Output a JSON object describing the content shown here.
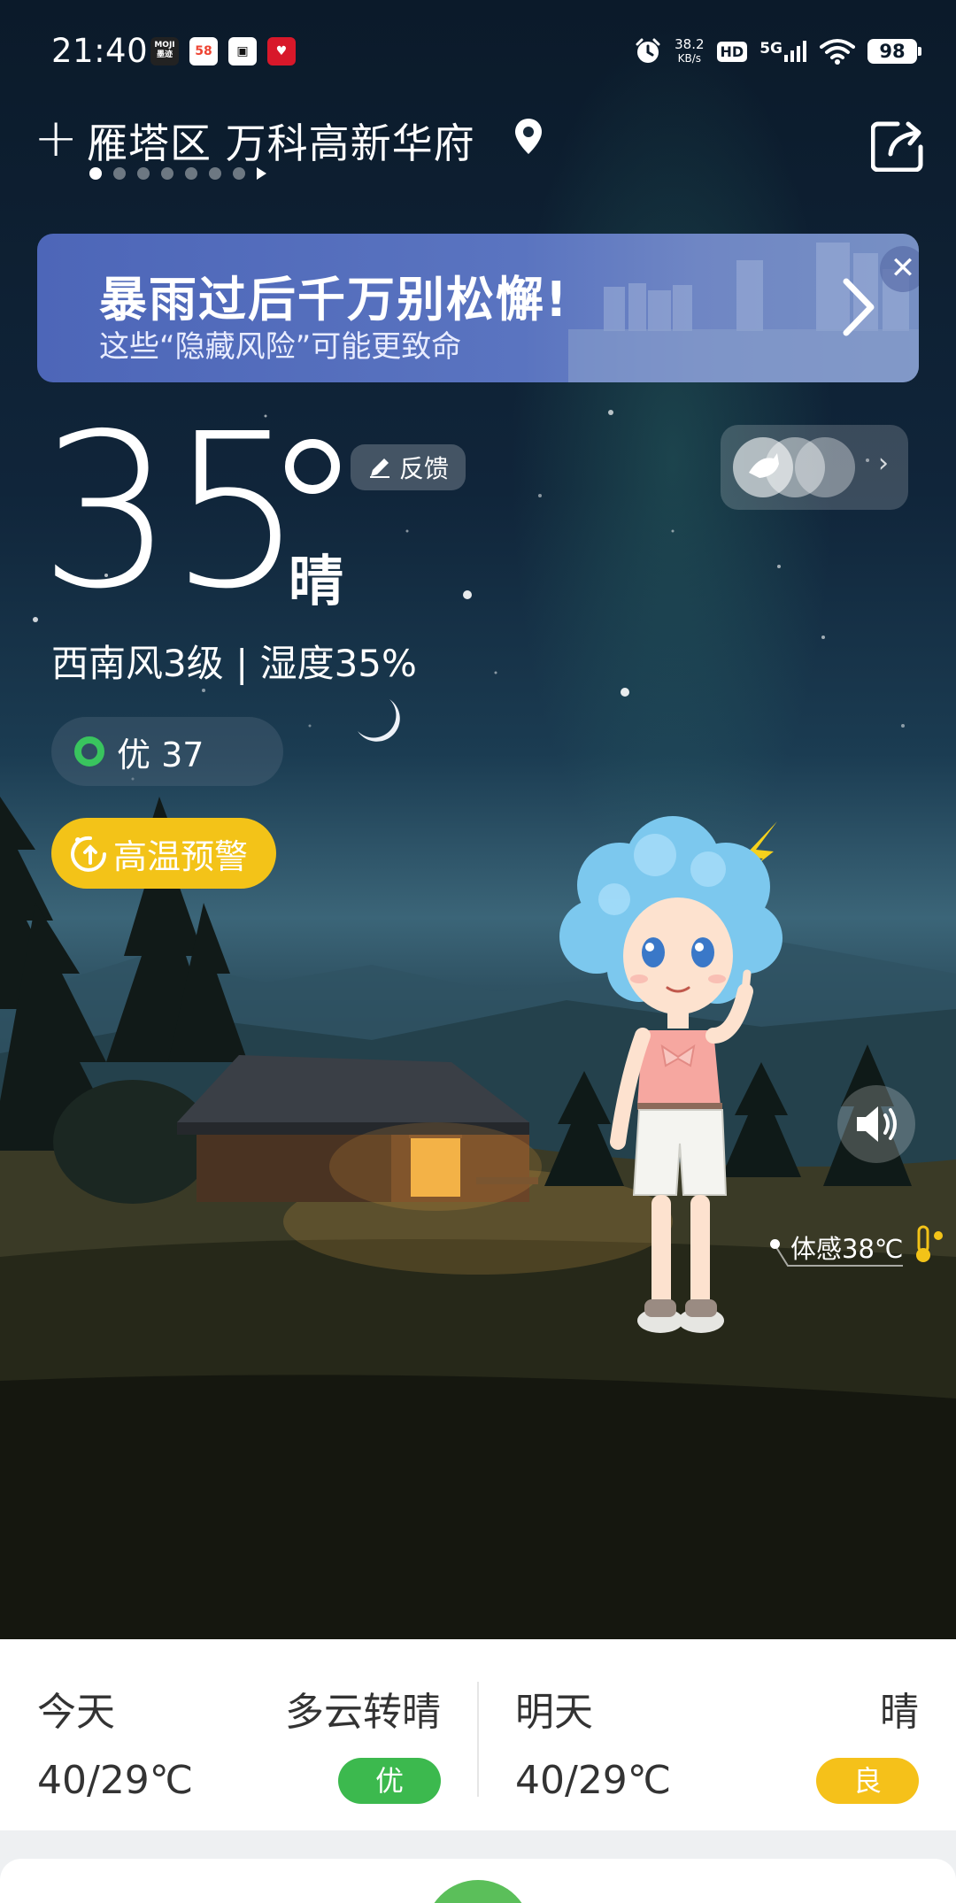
{
  "status_bar": {
    "time": "21:40",
    "app_icons": [
      "moji-weather-icon",
      "58-app-icon",
      "message-app-icon",
      "heart-app-icon"
    ],
    "net_speed_value": "38.2",
    "net_speed_unit": "KB/s",
    "hd_label": "HD",
    "network_label": "5G",
    "battery": "98"
  },
  "header": {
    "add_label": "+",
    "location": "雁塔区 万科高新华府",
    "page_count": 7,
    "active_page": 0
  },
  "banner": {
    "title": "暴雨过后千万别松懈!",
    "subtitle": "这些“隐藏风险”可能更致命",
    "close_label": "✕"
  },
  "current": {
    "temperature": "35",
    "condition": "晴",
    "feedback_label": "反馈",
    "wind_humidity": "西南风3级 | 湿度35%",
    "aqi_label": "优 37",
    "alert_label": "高温预警",
    "feels_like": "体感38℃"
  },
  "forecast": {
    "today": {
      "day": "今天",
      "condition": "多云转晴",
      "temp": "40/29℃",
      "aqi": "优",
      "aqi_color": "#3cb94e"
    },
    "tomorrow": {
      "day": "明天",
      "condition": "晴",
      "temp": "40/29℃",
      "aqi": "良",
      "aqi_color": "#f5c11a"
    }
  },
  "colors": {
    "aqi_good": "#39c45e",
    "alert_yellow": "#f3c318",
    "banner_blue": "#4d66b8"
  }
}
